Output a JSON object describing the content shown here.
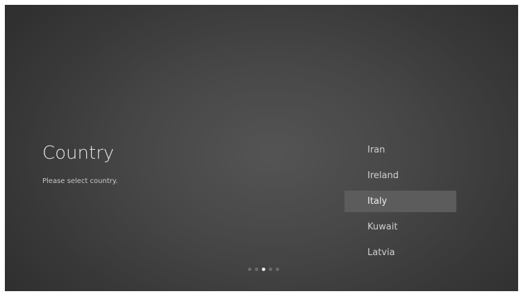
{
  "page": {
    "title": "Country",
    "subtitle": "Please select country."
  },
  "countries": [
    {
      "label": "Iran"
    },
    {
      "label": "Ireland"
    },
    {
      "label": "Italy"
    },
    {
      "label": "Kuwait"
    },
    {
      "label": "Latvia"
    }
  ],
  "selected_country": "Italy",
  "pager": {
    "total_steps": 5,
    "current_step": 3
  },
  "colors": {
    "background": "#474747",
    "highlight": "#5c5c5c",
    "text": "#d0d0d0",
    "active_dot": "#e8e8e8",
    "inactive_dot": "#6a6a6a"
  }
}
